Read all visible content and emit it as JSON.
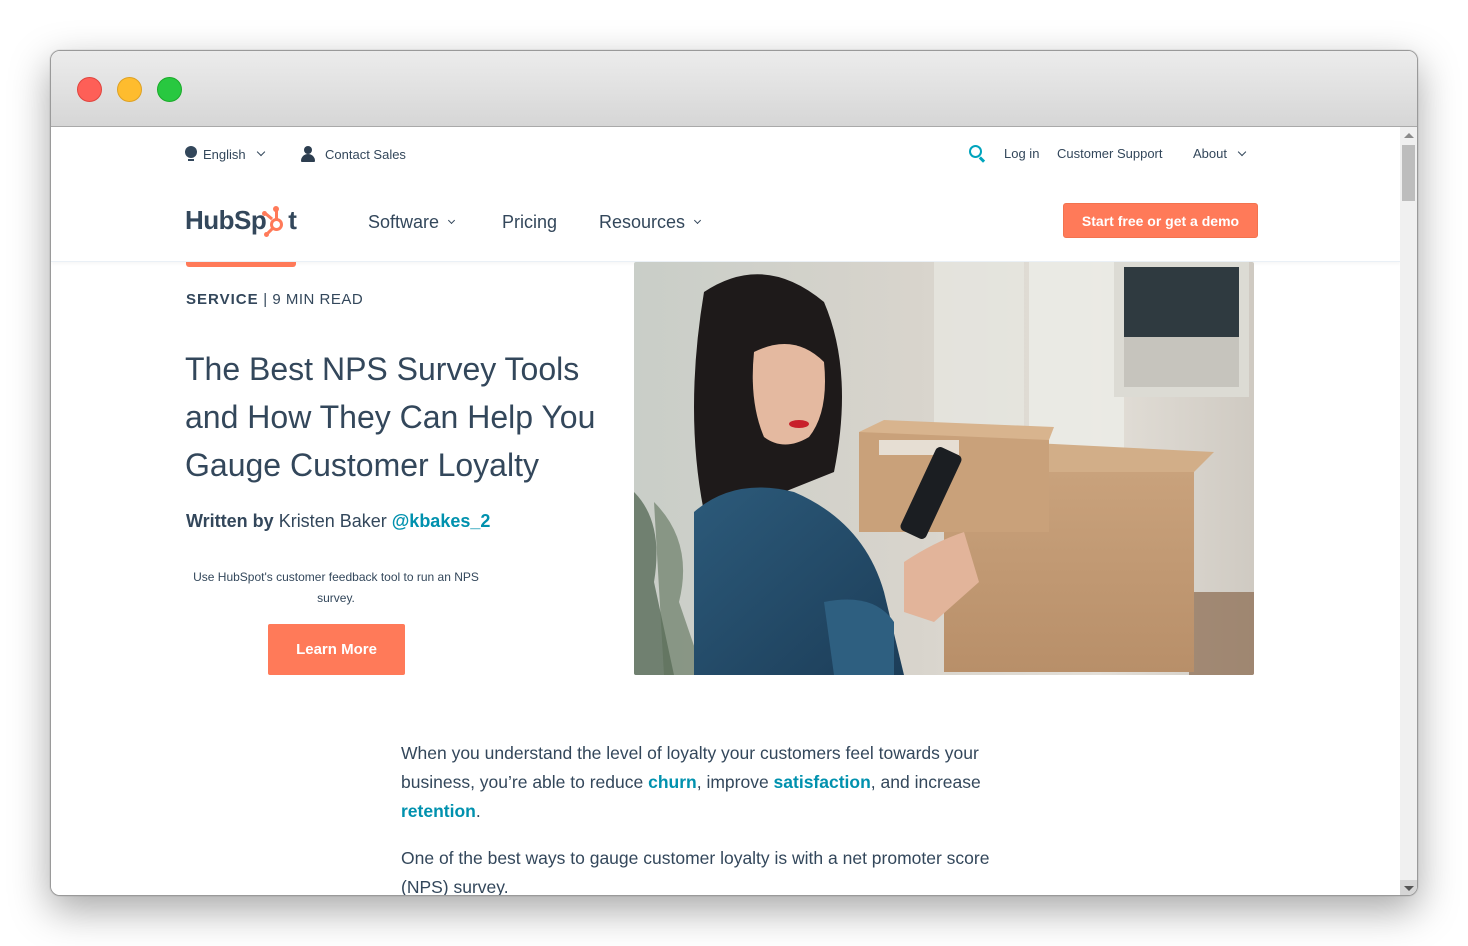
{
  "browser": {
    "traffic_lights": [
      "close",
      "minimize",
      "maximize"
    ]
  },
  "utility_nav": {
    "language": "English",
    "contact": "Contact Sales",
    "login": "Log in",
    "support": "Customer Support",
    "about": "About"
  },
  "main_nav": {
    "logo_text_before": "HubSp",
    "logo_text_after": "t",
    "items": [
      {
        "label": "Software",
        "has_dropdown": true
      },
      {
        "label": "Pricing",
        "has_dropdown": false
      },
      {
        "label": "Resources",
        "has_dropdown": true
      }
    ],
    "cta": "Start free or get a demo"
  },
  "article": {
    "category": "SERVICE",
    "separator": "|",
    "read_time": "9 MIN READ",
    "title": "The Best NPS Survey Tools and How They Can Help You Gauge Customer Loyalty",
    "byline_prefix": "Written by",
    "author": "Kristen Baker",
    "author_handle": "@kbakes_2",
    "promo_text": "Use HubSpot's customer feedback tool to run an NPS survey.",
    "promo_button": "Learn More",
    "hero_image_alt": "Woman holding cardboard boxes looking at smartphone",
    "paragraphs": {
      "p1_a": "When you understand the level of loyalty your customers feel towards your business, you’re able to reduce ",
      "p1_link1": "churn",
      "p1_b": ", improve ",
      "p1_link2": "satisfaction",
      "p1_c": ", and increase ",
      "p1_link3": "retention",
      "p1_d": ".",
      "p2": "One of the best ways to gauge customer loyalty is with a net promoter score (NPS) survey."
    }
  },
  "colors": {
    "brand_orange": "#ff7a59",
    "text_dark": "#33475b",
    "link_teal": "#0091ae",
    "search_teal": "#00a4bd"
  }
}
